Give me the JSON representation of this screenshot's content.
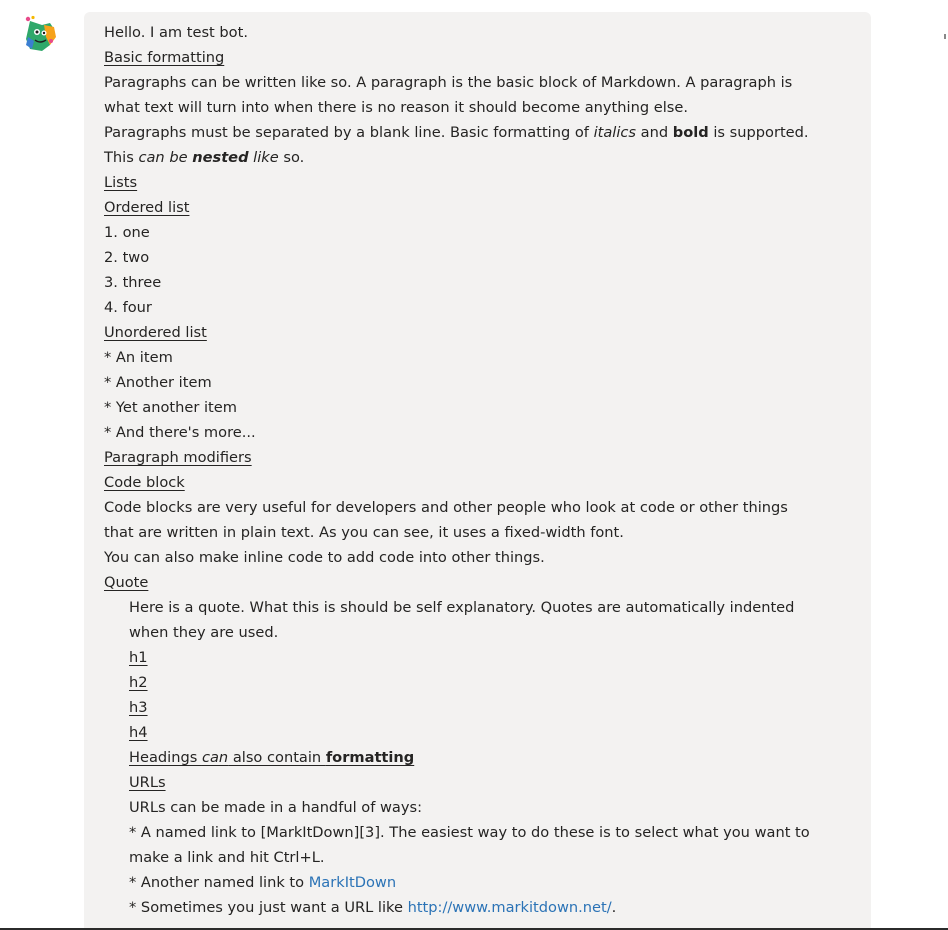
{
  "message": {
    "greeting": "Hello. I am test bot.",
    "basic_heading": "Basic formatting",
    "para1_line1": "Paragraphs can be written like so. A paragraph is the basic block of Markdown. A paragraph is",
    "para1_line2": "what text will turn into when there is no reason it should become anything else.",
    "para2_part1": "Paragraphs must be separated by a blank line. Basic formatting of ",
    "para2_italic": "italics",
    "para2_part2": " and ",
    "para2_bold": "bold",
    "para2_part3": " is supported.",
    "para3_part1": "This ",
    "para3_italic1": "can be ",
    "para3_bolditalic": "nested",
    "para3_italic2": " like",
    "para3_part2": " so.",
    "lists_heading": "Lists",
    "ordered_heading": "Ordered list",
    "ordered_items": [
      "1. one",
      "2. two",
      "3. three",
      "4. four"
    ],
    "unordered_heading": "Unordered list",
    "unordered_items": [
      "* An item",
      "* Another item",
      "* Yet another item",
      "* And there's more..."
    ],
    "modifiers_heading": "Paragraph modifiers",
    "code_heading": "Code block",
    "code_line1": "Code blocks are very useful for developers and other people who look at code or other things",
    "code_line2": "that are written in plain text. As you can see, it uses a fixed-width font.",
    "inline_code_line": "You can also make inline code to add code into other things.",
    "quote_heading": "Quote",
    "quote_line1": "Here is a quote. What this is should be self explanatory. Quotes are automatically indented",
    "quote_line2": "when they are used.",
    "h1": "h1",
    "h2": "h2",
    "h3": "h3",
    "h4": "h4",
    "headings_part1": "Headings ",
    "headings_italic": "can",
    "headings_part2": " also contain ",
    "headings_bold": "formatting",
    "urls_heading": "URLs",
    "urls_intro": "URLs can be made in a handful of ways:",
    "url_item1_line1": "* A named link to [MarkItDown][3]. The easiest way to do these is to select what you want to",
    "url_item1_line2": "make a link and hit Ctrl+L.",
    "url_item2_text": "* Another named link to ",
    "url_item2_link": "MarkItDown",
    "url_item3_text": "* Sometimes you just want a URL like ",
    "url_item3_link": "http://www.markitdown.net/",
    "url_item3_end": "."
  },
  "colors": {
    "bubble_background": "#f3f2f1",
    "text": "#252423",
    "link": "#2b73b6"
  },
  "icons": {
    "avatar": "bot-avatar-icon"
  }
}
